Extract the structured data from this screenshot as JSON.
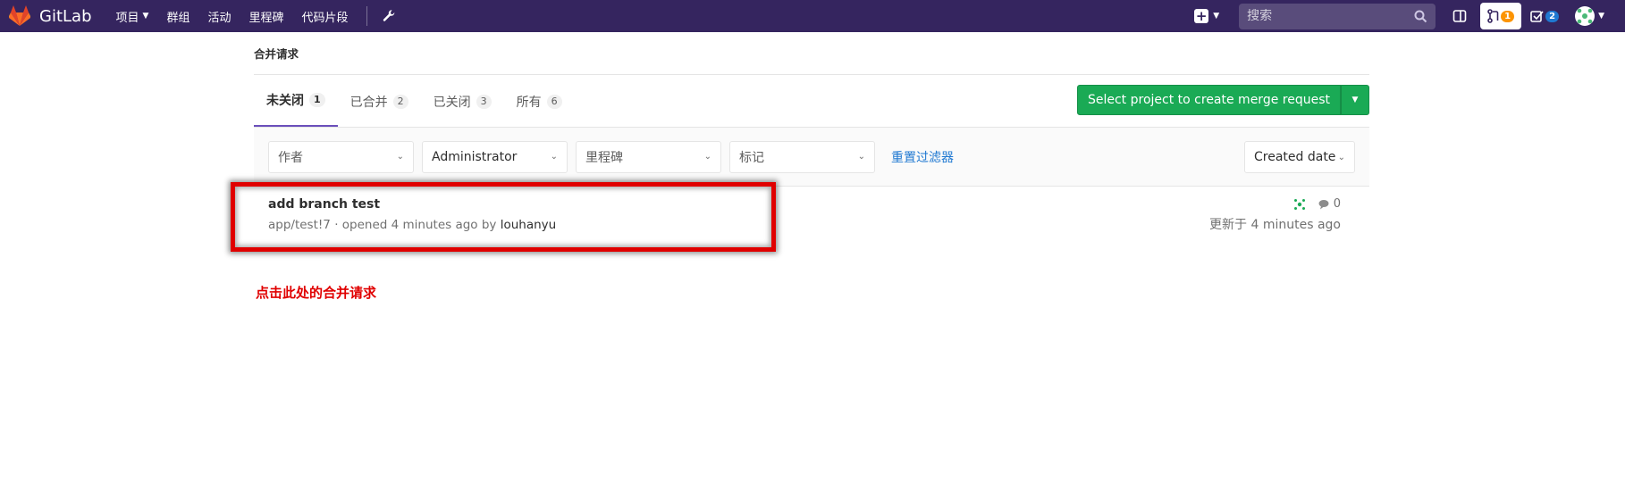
{
  "navbar": {
    "brand": "GitLab",
    "links": [
      {
        "label": "项目",
        "has_caret": true
      },
      {
        "label": "群组"
      },
      {
        "label": "活动"
      },
      {
        "label": "里程碑"
      },
      {
        "label": "代码片段"
      }
    ],
    "search_placeholder": "搜索",
    "mr_badge": "1",
    "todo_badge": "2",
    "bg_color": "#35255f"
  },
  "page": {
    "breadcrumb": "合并请求",
    "tabs": [
      {
        "label": "未关闭",
        "count": "1",
        "active": true
      },
      {
        "label": "已合并",
        "count": "2"
      },
      {
        "label": "已关闭",
        "count": "3"
      },
      {
        "label": "所有",
        "count": "6"
      }
    ],
    "create_button": "Select project to create merge request",
    "filters": {
      "author": "作者",
      "assignee": "Administrator",
      "milestone": "里程碑",
      "label": "标记",
      "reset": "重置过滤器",
      "sort": "Created date"
    }
  },
  "merge_requests": [
    {
      "title": "add branch test",
      "reference": "app/test!7",
      "opened_text": "· opened 4 minutes ago by",
      "author": "louhanyu",
      "comments": "0",
      "updated": "更新于 4 minutes ago"
    }
  ],
  "annotation": {
    "text": "点击此处的合并请求",
    "color": "#e00000"
  },
  "colors": {
    "accent": "#6b4fbb",
    "create_green": "#1aaa55",
    "link_blue": "#1f78d1"
  }
}
